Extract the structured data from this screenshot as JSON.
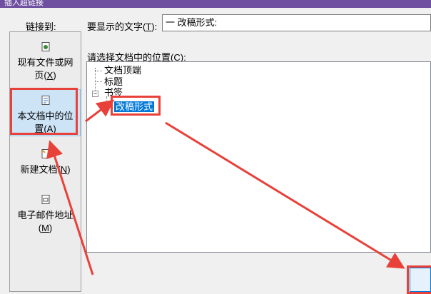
{
  "titlebar": {
    "title": "插入超链接"
  },
  "sidebar": {
    "label": "链接到:",
    "items": [
      {
        "line1": "现有文件或网",
        "line2": "页(",
        "key": "X",
        "end": ")"
      },
      {
        "line1": "本文档中的位",
        "line2": "置(",
        "key": "A",
        "end": ")"
      },
      {
        "line1": "新建文档(",
        "key": "N",
        "end": ")"
      },
      {
        "line1": "电子邮件地址",
        "line2": "(",
        "key": "M",
        "end": ")"
      }
    ]
  },
  "display_text": {
    "label": "要显示的文字(",
    "key": "T",
    "end": "):",
    "value": "一 改稿形式:"
  },
  "place": {
    "label": "请选择文档中的位置(",
    "key": "C",
    "end": "):"
  },
  "tree": {
    "nodes": [
      "文档顶端",
      "标题",
      "书签",
      "改稿形式"
    ],
    "expander": "−"
  },
  "colors": {
    "annotation": "#e8413a",
    "selection": "#0078d7",
    "title_bar": "#6e4fa0"
  }
}
